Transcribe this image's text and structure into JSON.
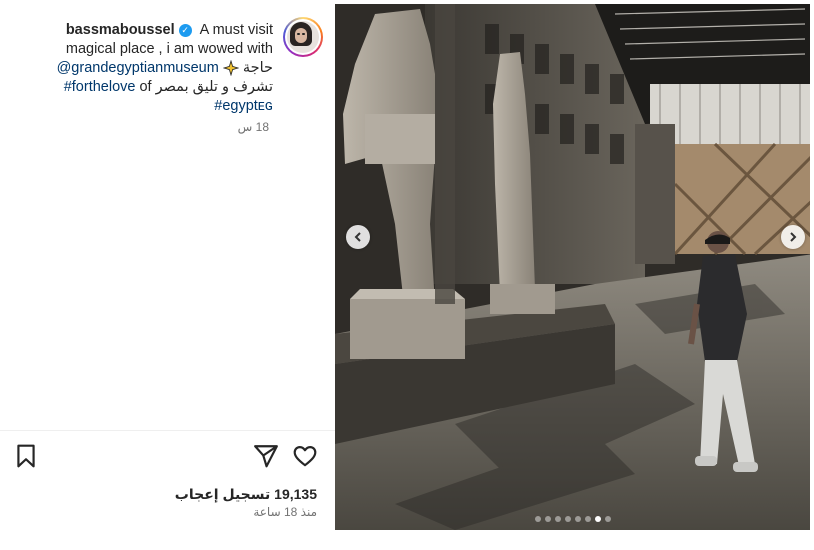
{
  "post": {
    "username": "bassmaboussel",
    "caption_part1": "A must visit",
    "caption_line2": "magical place , i am wowed with",
    "caption_word_haja": "حاجة",
    "mention": "@grandegyptianmuseum",
    "caption_of": "of",
    "hashtag1": "#forthelove",
    "caption_arabic": "تشرف و تليق بمصر",
    "hashtag2": "#egyptᴇɢ",
    "time_short": "18 س",
    "likes_text": "19,135 تسجيل إعجاب",
    "time_ago": "منذ 18 ساعة"
  },
  "carousel": {
    "dot_count": 8,
    "active_index": 6
  },
  "icons": {
    "avatar": "profile-avatar",
    "verified": "verified-badge-icon",
    "like": "heart-icon",
    "share": "paper-plane-icon",
    "save": "bookmark-icon",
    "prev": "chevron-left-icon",
    "next": "chevron-right-icon"
  },
  "colors": {
    "link": "#00376b",
    "verified": "#1d9bf0",
    "muted": "#737373"
  }
}
